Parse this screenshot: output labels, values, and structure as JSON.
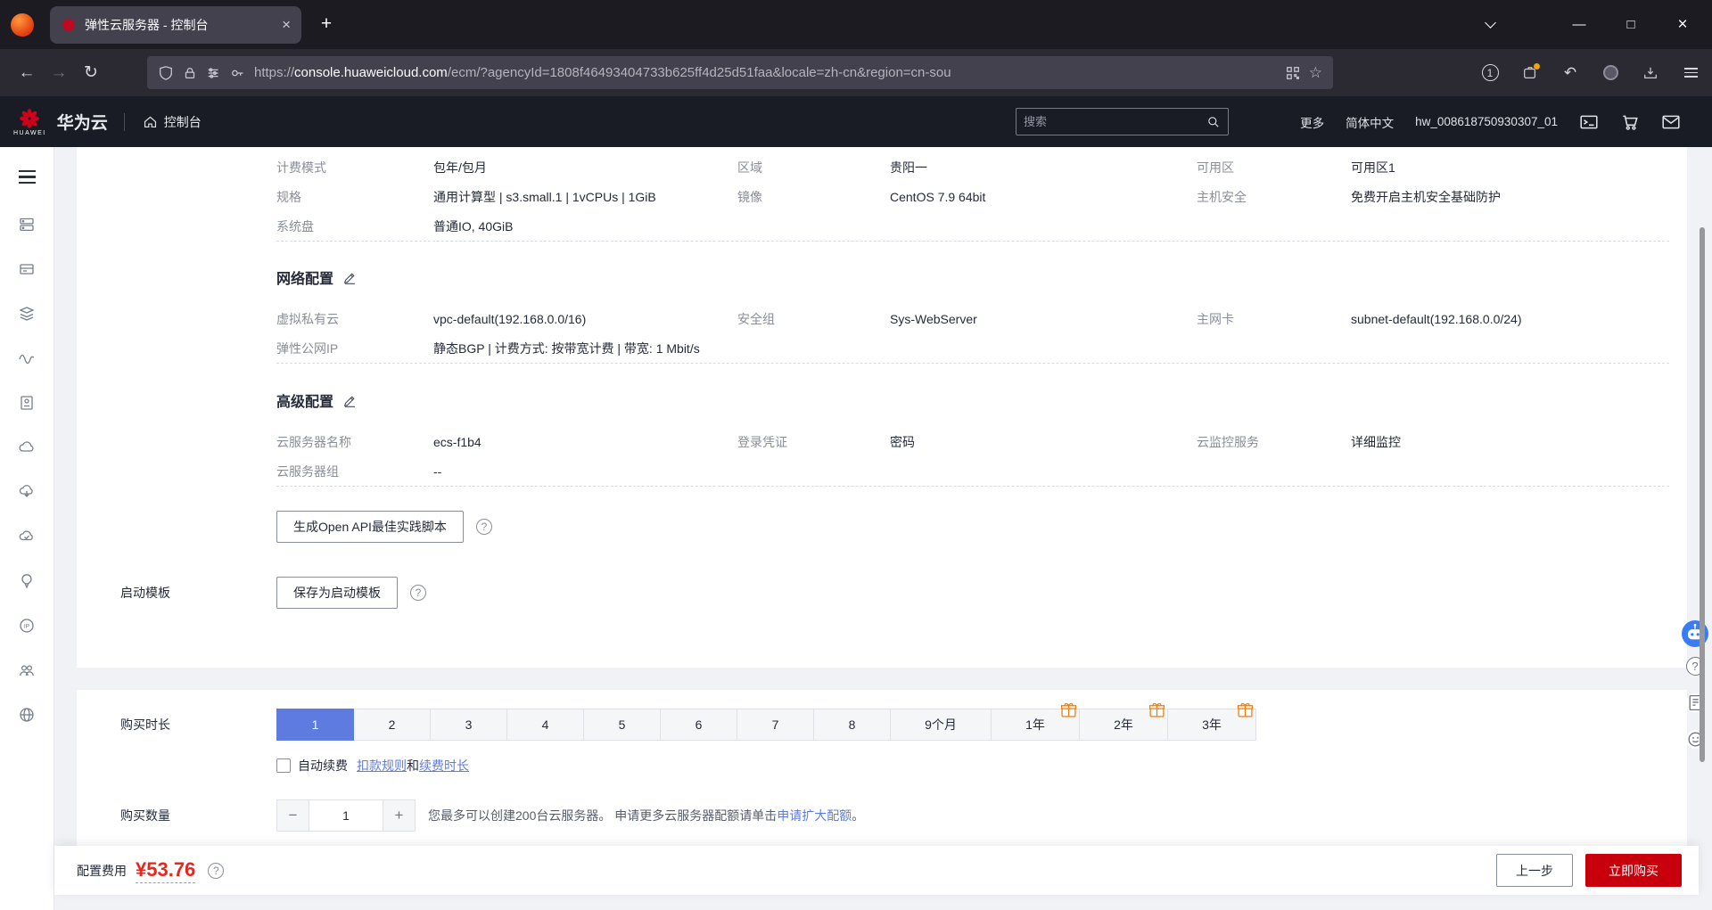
{
  "colors": {
    "accent_blue": "#5e7ce0",
    "price_red": "#e8271c",
    "buy_red": "#c7000b",
    "gift_orange": "#f57c00",
    "header_dark": "#191c24"
  },
  "browser": {
    "tab_title": "弹性云服务器 - 控制台",
    "url_prefix": "https://",
    "url_domain": "console.huaweicloud.com",
    "url_path": "/ecm/?agencyId=1808f46493404733b625ff4d25d51faa&locale=zh-cn&region=cn-sou",
    "toolbar_count_badge": "1"
  },
  "glyphs": {
    "close": "×",
    "new_tab": "+",
    "back": "←",
    "forward": "→",
    "reload": "↻",
    "star": "☆",
    "undo": "↶",
    "question": "?",
    "minimize": "—",
    "minus": "−",
    "plus": "+",
    "ip": "IP"
  },
  "header": {
    "logo_text": "HUAWEI",
    "brand": "华为云",
    "console": "控制台",
    "search_placeholder": "搜索",
    "more": "更多",
    "language": "简体中文",
    "account": "hw_008618750930307_01"
  },
  "basic": {
    "rows": [
      {
        "cols": [
          {
            "label": "计费模式",
            "value": "包年/包月"
          },
          {
            "label": "区域",
            "value": "贵阳一"
          },
          {
            "label": "可用区",
            "value": "可用区1"
          }
        ]
      },
      {
        "cols": [
          {
            "label": "规格",
            "value": "通用计算型 | s3.small.1 | 1vCPUs | 1GiB"
          },
          {
            "label": "镜像",
            "value": "CentOS 7.9 64bit"
          },
          {
            "label": "主机安全",
            "value": "免费开启主机安全基础防护"
          }
        ]
      },
      {
        "cols": [
          {
            "label": "系统盘",
            "value": "普通IO, 40GiB"
          }
        ]
      }
    ]
  },
  "network": {
    "title": "网络配置",
    "rows": [
      {
        "cols": [
          {
            "label": "虚拟私有云",
            "value": "vpc-default(192.168.0.0/16)"
          },
          {
            "label": "安全组",
            "value": "Sys-WebServer"
          },
          {
            "label": "主网卡",
            "value": "subnet-default(192.168.0.0/24)"
          }
        ]
      },
      {
        "cols": [
          {
            "label": "弹性公网IP",
            "value": "静态BGP | 计费方式: 按带宽计费 | 带宽: 1 Mbit/s"
          }
        ]
      }
    ]
  },
  "advanced": {
    "title": "高级配置",
    "rows": [
      {
        "cols": [
          {
            "label": "云服务器名称",
            "value": "ecs-f1b4"
          },
          {
            "label": "登录凭证",
            "value": "密码"
          },
          {
            "label": "云监控服务",
            "value": "详细监控"
          }
        ]
      },
      {
        "cols": [
          {
            "label": "云服务器组",
            "value": "--"
          }
        ]
      }
    ]
  },
  "actions": {
    "api_script_button": "生成Open API最佳实践脚本",
    "launch_template_label": "启动模板",
    "save_template_button": "保存为启动模板"
  },
  "purchase": {
    "duration_label": "购买时长",
    "duration_options": [
      "1",
      "2",
      "3",
      "4",
      "5",
      "6",
      "7",
      "8",
      "9个月",
      "1年",
      "2年",
      "3年"
    ],
    "auto_renew_label": "自动续费",
    "deduction_rules_link": "扣款规则",
    "and_text": "和",
    "renew_duration_link": "续费时长",
    "quantity_label": "购买数量",
    "quantity_value": "1",
    "quota_text": "您最多可以创建200台云服务器。 申请更多云服务器配额请单击",
    "quota_link": "申请扩大配额",
    "quota_suffix": "。"
  },
  "footer": {
    "fee_label": "配置费用",
    "fee_value": "¥53.76",
    "prev_button": "上一步",
    "buy_button": "立即购买"
  }
}
